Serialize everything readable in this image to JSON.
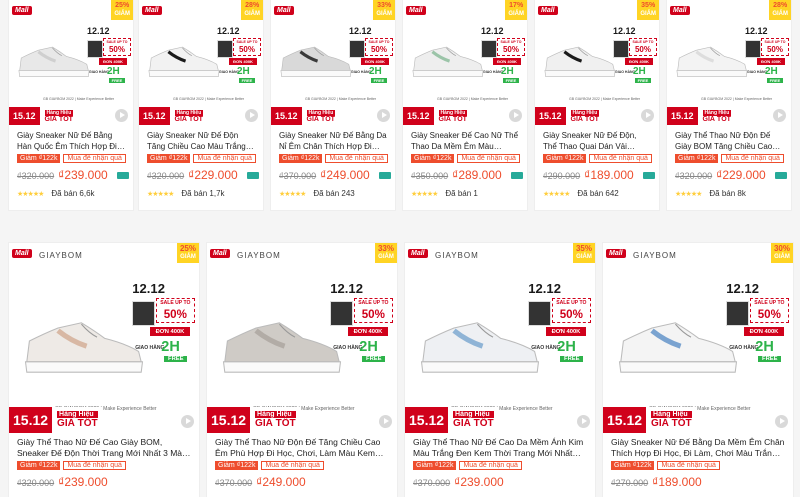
{
  "mall_label": "Mall",
  "brand": "GIAYBOM",
  "promo": {
    "date_big": "12.12",
    "sale_label": "SALE UP TO",
    "sale_pct": "50%",
    "don_label": "ĐƠN 400K",
    "giao": "GIAO HÀNG",
    "two_h": "2H",
    "free": "FREE",
    "banner_date": "15.12",
    "hang_hieu": "Hàng Hiệu",
    "gia_tot": "GIÁ TỐT",
    "note_small": "GB GIAYBOM 2022 | Make Experience Better"
  },
  "badges": {
    "coupon": "Giảm ₫122k",
    "combo": "Mua để nhận quà"
  },
  "row1": [
    {
      "disc": "25%",
      "giam": "GIẢM",
      "title": "Giày Sneaker Nữ Đế Bằng Hàn Quốc Êm Thích Hợp Đi Làm, ...",
      "old": "₫320.000",
      "new": "₫239.000",
      "sold": "Đã bán 6,6k",
      "shoe_color": "#e8e8e8",
      "accent": "#cfcfcf"
    },
    {
      "disc": "28%",
      "giam": "GIẢM",
      "title": "Giày Sneaker Nữ Đế Độn Tăng Chiều Cao Màu Trắng Kiểu Hà...",
      "old": "₫320.000",
      "new": "₫229.000",
      "sold": "Đã bán 1,7k",
      "shoe_color": "#f2f2f2",
      "accent": "#1a1a1a"
    },
    {
      "disc": "33%",
      "giam": "GIẢM",
      "title": "Giày Sneaker Nữ Đế Bằng Da Nỉ Êm Chân Thích Hợp Đi Là...",
      "old": "₫370.000",
      "new": "₫249.000",
      "sold": "Đã bán 243",
      "shoe_color": "#d9d9d9",
      "accent": "#3a3a3a"
    },
    {
      "disc": "17%",
      "giam": "GIẢM",
      "title": "Giày Sneaker Đế Cao Nữ Thể Thao Da Mềm Êm Màu Trắng...",
      "old": "₫350.000",
      "new": "₫289.000",
      "sold": "Đã bán 1",
      "shoe_color": "#eeeeee",
      "accent": "#9bc4a8"
    },
    {
      "disc": "35%",
      "giam": "GIẢM",
      "title": "Giày Sneaker Nữ Đế Độn, Thể Thao Quai Dán Vải Canvas M...",
      "old": "₫290.000",
      "new": "₫189.000",
      "sold": "Đã bán 642",
      "shoe_color": "#f0f0f0",
      "accent": "#1a1a1a"
    },
    {
      "disc": "28%",
      "giam": "GIẢM",
      "title": "Giày Thể Thao Nữ Độn Đế Giày BOM Tăng Chiều Cao Màu...",
      "old": "₫320.000",
      "new": "₫229.000",
      "sold": "Đã bán 8k",
      "shoe_color": "#f3f3f3",
      "accent": "#dddddd"
    }
  ],
  "row2": [
    {
      "disc": "25%",
      "giam": "GIẢM",
      "title": "Giày Thể Thao Nữ Đế Cao Giày BOM, Sneaker Đế Độn Thời Trang Mới Nhất 3 Màu Trắng Tím Nâu...",
      "old": "₫320.000",
      "new": "₫239.000",
      "shoe_color": "#eeeae6",
      "accent": "#d8b8a4"
    },
    {
      "disc": "33%",
      "giam": "GIẢM",
      "title": "Giày Thể Thao Nữ Độn Đế Tăng Chiều Cao Êm Phù Hợp Đi Học, Chơi, Làm Màu Kem Mới Nhất...",
      "old": "₫370.000",
      "new": "₫249.000",
      "shoe_color": "#cfcbc6",
      "accent": "#b2aca6"
    },
    {
      "disc": "35%",
      "giam": "GIẢM",
      "title": "Giày Thể Thao Nữ Đế Cao Da Mềm Ánh Kim Màu Trắng Đen Kem Thời Trang Mới Nhất giayBOM...",
      "old": "₫370.000",
      "new": "₫239.000",
      "shoe_color": "#eef0f3",
      "accent": "#8fb4d6"
    },
    {
      "disc": "30%",
      "giam": "GIẢM",
      "title": "Giày Sneaker Nữ Đế Bằng Da Mềm Êm Chân Thích Hợp Đi Học, Đi Làm, Chơi Màu Trắng giayBOM ...",
      "old": "₫270.000",
      "new": "₫189.000",
      "shoe_color": "#f4f4f4",
      "accent": "#7aa3d0"
    }
  ]
}
